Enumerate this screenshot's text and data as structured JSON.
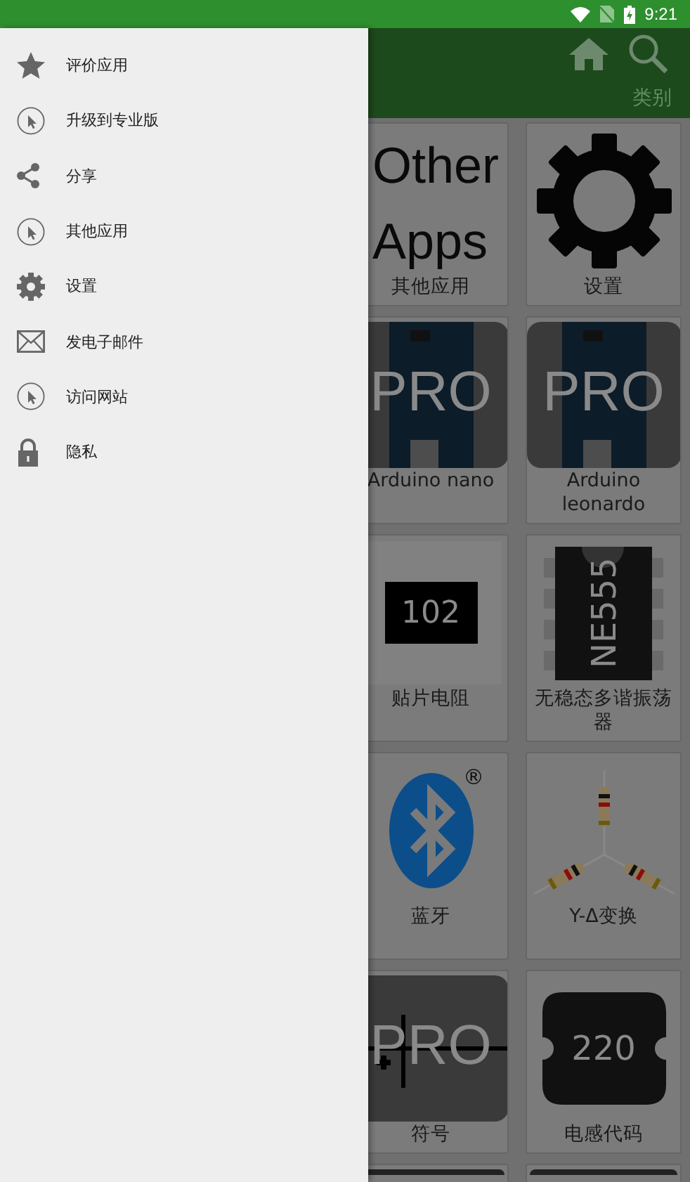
{
  "status_bar": {
    "time": "9:21"
  },
  "drawer": {
    "items": [
      {
        "kind": "star",
        "label": "评价应用"
      },
      {
        "kind": "cursor",
        "label": "升级到专业版"
      },
      {
        "kind": "share",
        "label": "分享"
      },
      {
        "kind": "cursor",
        "label": "其他应用"
      },
      {
        "kind": "gear",
        "label": "设置"
      },
      {
        "kind": "mail",
        "label": "发电子邮件"
      },
      {
        "kind": "cursor",
        "label": "访问网站"
      },
      {
        "kind": "lock",
        "label": "隐私"
      }
    ]
  },
  "tab_label": "类别",
  "tiles": [
    {
      "kind": "words",
      "art_text": [
        "Other",
        "Apps"
      ],
      "label": "其他应用"
    },
    {
      "kind": "gear",
      "label": "设置"
    },
    {
      "kind": "board",
      "badge": "PRO",
      "label": "Arduino nano"
    },
    {
      "kind": "board",
      "badge": "PRO",
      "label": "Arduino leonardo"
    },
    {
      "kind": "smd",
      "art_text": [
        "102"
      ],
      "label": "贴片电阻"
    },
    {
      "kind": "ic",
      "art_text": [
        "NE555"
      ],
      "label": "无稳态多谐振荡器"
    },
    {
      "kind": "bluetooth",
      "art_text": [
        "®"
      ],
      "label": "蓝牙"
    },
    {
      "kind": "wye",
      "label": "Y-Δ变换"
    },
    {
      "kind": "symbol",
      "badge": "PRO",
      "label": "符号"
    },
    {
      "kind": "inductor",
      "art_text": [
        "220"
      ],
      "label": "电感代码"
    },
    {
      "kind": "blank"
    },
    {
      "kind": "blank"
    }
  ]
}
